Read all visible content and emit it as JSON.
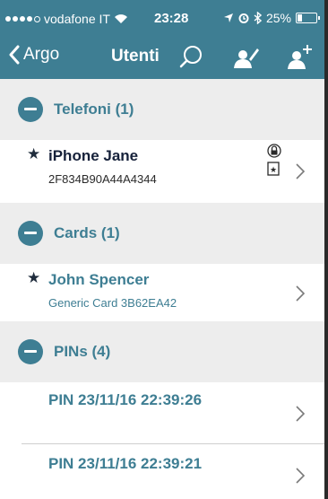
{
  "status_bar": {
    "carrier": "vodafone IT",
    "time": "23:28",
    "battery": "25%",
    "battery_level": 0.25
  },
  "nav": {
    "back_label": "Argo",
    "title": "Utenti",
    "icons": [
      "search-icon",
      "edit-user-icon",
      "add-user-icon"
    ]
  },
  "sections": [
    {
      "title": "Telefoni (1)",
      "items": [
        {
          "name": "iPhone Jane",
          "subtitle": "2F834B90A44A4344",
          "starred": true,
          "icons": [
            "lock-icon",
            "starred-badge-icon"
          ]
        }
      ]
    },
    {
      "title": "Cards (1)",
      "items": [
        {
          "name": "John Spencer",
          "subtitle": "Generic Card 3B62EA42",
          "starred": true
        }
      ]
    },
    {
      "title": "PINs (4)",
      "items": [
        {
          "name": "PIN 23/11/16 22:39:26",
          "starred": false
        },
        {
          "name": "PIN 23/11/16 22:39:21",
          "starred": false
        }
      ]
    }
  ],
  "colors": {
    "accent": "#3e7e93",
    "section_bg": "#ededed",
    "text_dark": "#16213a"
  }
}
